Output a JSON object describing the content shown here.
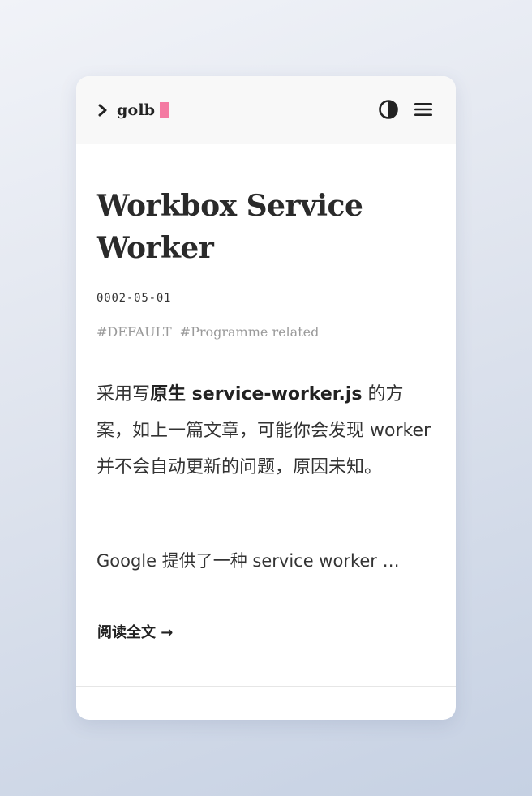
{
  "header": {
    "brand": "golb",
    "icons": {
      "prompt": "chevron-right-icon",
      "theme": "contrast-toggle-icon",
      "menu": "hamburger-menu-icon"
    },
    "cursor_color": "#f47aa2"
  },
  "post": {
    "title": "Workbox Service Worker",
    "date": "0002-05-01",
    "tags": [
      "#DEFAULT",
      "#Programme related"
    ],
    "excerpt": {
      "p1_before": "采用写",
      "p1_bold": "原生 service-worker.js",
      "p1_after": " 的方案，如上一篇文章，可能你会发现 worker 并不会自动更新的问题，原因未知。",
      "p2": "Google 提供了一种 service worker …"
    },
    "read_more": "阅读全文 →"
  }
}
